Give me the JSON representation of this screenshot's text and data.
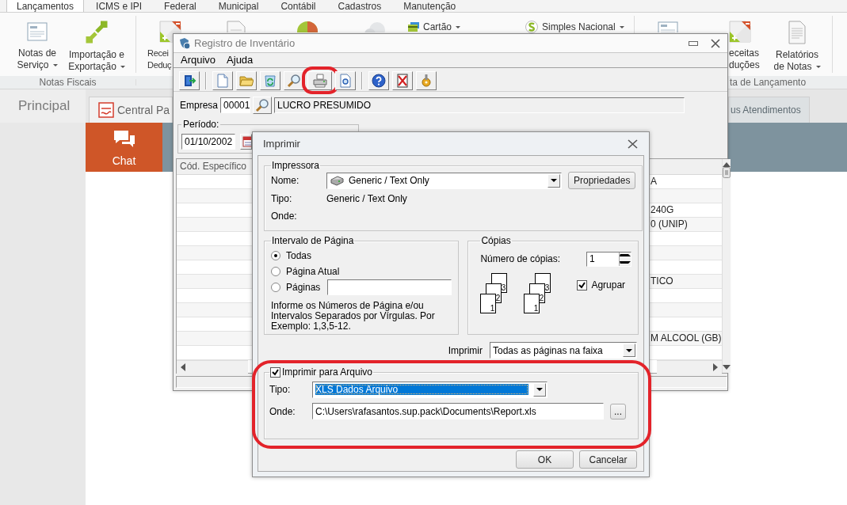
{
  "ribbon": {
    "tabs": [
      {
        "label": "Lançamentos",
        "selected": true
      },
      {
        "label": "ICMS e IPI",
        "selected": false
      },
      {
        "label": "Federal",
        "selected": false
      },
      {
        "label": "Municipal",
        "selected": false
      },
      {
        "label": "Contábil",
        "selected": false
      },
      {
        "label": "Cadastros",
        "selected": false
      },
      {
        "label": "Manutenção",
        "selected": false
      }
    ],
    "items": [
      {
        "kind": "large",
        "lines": [
          "Notas de",
          "Serviço"
        ],
        "dropdown": true
      },
      {
        "kind": "large",
        "lines": [
          "Importação e",
          "Exportação"
        ],
        "dropdown": true
      },
      {
        "kind": "large",
        "lines": [
          "Recei",
          "Deduç"
        ],
        "dropdown": false
      },
      {
        "kind": "icon"
      },
      {
        "kind": "icon"
      },
      {
        "kind": "icon"
      },
      {
        "kind": "small",
        "lines": [
          "Cartão"
        ],
        "dropdown": true
      },
      {
        "kind": "small",
        "lines": [
          "Simples Nacional"
        ],
        "dropdown": true
      },
      {
        "kind": "icon"
      },
      {
        "kind": "large",
        "lines": [
          "eceitas",
          "duções"
        ],
        "dropdown": false
      },
      {
        "kind": "large",
        "lines": [
          "Relatórios",
          "de Notas"
        ],
        "dropdown": true
      }
    ],
    "group_labels": [
      "Notas Fiscais",
      "ta de Lançamento"
    ]
  },
  "workspace": {
    "title": "Principal",
    "tabs": [
      {
        "label": "Central Pa",
        "selected": true
      },
      {
        "label": "us Atendimentos",
        "selected": false
      }
    ],
    "chat": {
      "label": "Chat"
    }
  },
  "inventory": {
    "title": "Registro de Inventário",
    "menu": [
      "Arquivo",
      "Ajuda"
    ],
    "toolbar": [
      {
        "kind": "exit",
        "highlighted": false
      },
      {
        "kind": "new",
        "highlighted": false
      },
      {
        "kind": "open",
        "highlighted": false
      },
      {
        "kind": "refresh",
        "highlighted": false
      },
      {
        "kind": "search",
        "highlighted": false
      },
      {
        "kind": "print",
        "highlighted": true
      },
      {
        "kind": "preview",
        "highlighted": false
      },
      {
        "kind": "help",
        "highlighted": false
      },
      {
        "kind": "delete",
        "highlighted": false
      },
      {
        "kind": "tools",
        "highlighted": false
      }
    ],
    "empresa": {
      "label": "Empresa",
      "code": "00001",
      "name": "LUCRO PRESUMIDO"
    },
    "periodo": {
      "label": "Período:",
      "date": "01/10/2002"
    },
    "grid": {
      "columns": [
        "Cód. Específico"
      ],
      "rows": [
        {
          "column_2": "A"
        },
        {},
        {
          "column_2": "240G"
        },
        {
          "column_2": "0 (UNIP)"
        },
        {},
        {},
        {},
        {
          "column_2": "TICO"
        },
        {},
        {},
        {},
        {
          "column_2": "M ALCOOL (GB)"
        },
        {}
      ]
    }
  },
  "print_dialog": {
    "title": "Imprimir",
    "printer": {
      "legend": "Impressora",
      "name_label": "Nome:",
      "name": "Generic / Text Only",
      "properties_button": "Propriedades",
      "type_label": "Tipo:",
      "type": "Generic / Text Only",
      "where_label": "Onde:"
    },
    "range": {
      "legend": "Intervalo de Página",
      "options": [
        {
          "label": "Todas",
          "selected": true
        },
        {
          "label": "Página Atual",
          "selected": false
        },
        {
          "label": "Páginas",
          "selected": false
        }
      ],
      "hint": "Informe os Números de Página e/ou Intervalos Separados por Vírgulas. Por Exemplo: 1,3,5-12."
    },
    "copies": {
      "legend": "Cópias",
      "count_label": "Número de cópias:",
      "count": "1",
      "stacks": [
        {
          "pages": [
            "3",
            "2",
            "1"
          ]
        },
        {
          "pages": [
            "3",
            "2",
            "1"
          ]
        }
      ],
      "collate_label": "Agrupar",
      "collate": true
    },
    "print_label": "Imprimir",
    "print_select": "Todas as páginas na faixa",
    "to_file": {
      "label": "Imprimir para Arquivo",
      "checked": true,
      "highlighted": true,
      "type_label": "Tipo:",
      "type": "XLS Dados Arquivo",
      "where_label": "Onde:",
      "path": "C:\\Users\\rafasantos.sup.pack\\Documents\\Report.xls",
      "browse_button": "..."
    },
    "buttons": [
      "OK",
      "Cancelar"
    ]
  }
}
